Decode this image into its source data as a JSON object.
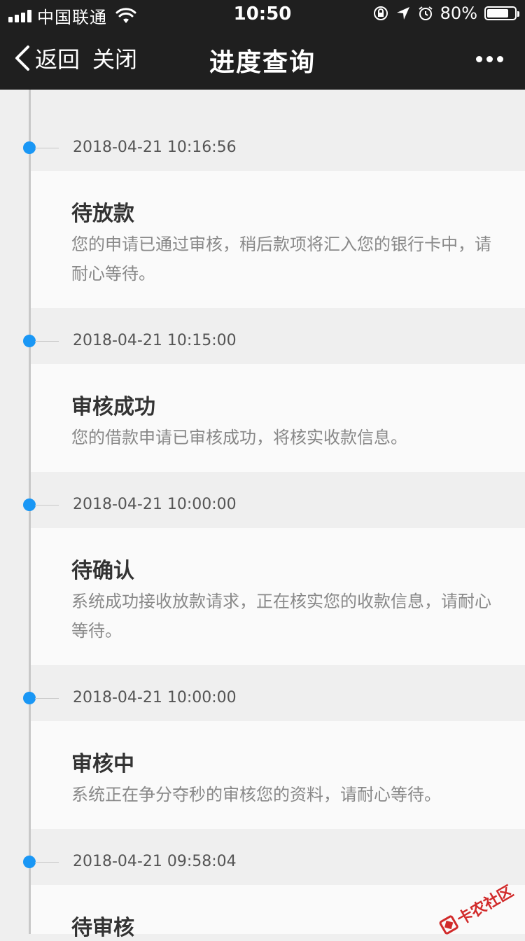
{
  "status_bar": {
    "carrier": "中国联通",
    "time": "10:50",
    "battery": "80%"
  },
  "nav": {
    "back_label": "返回",
    "close_label": "关闭",
    "title": "进度查询"
  },
  "entries": [
    {
      "time": "2018-04-21 10:16:56",
      "title": "待放款",
      "desc": "您的申请已通过审核，稍后款项将汇入您的银行卡中，请耐心等待。"
    },
    {
      "time": "2018-04-21 10:15:00",
      "title": "审核成功",
      "desc": "您的借款申请已审核成功，将核实收款信息。"
    },
    {
      "time": "2018-04-21 10:00:00",
      "title": "待确认",
      "desc": "系统成功接收放款请求，正在核实您的收款信息，请耐心等待。"
    },
    {
      "time": "2018-04-21 10:00:00",
      "title": "审核中",
      "desc": "系统正在争分夺秒的审核您的资料，请耐心等待。"
    },
    {
      "time": "2018-04-21 09:58:04",
      "title": "待审核",
      "desc": ""
    }
  ],
  "watermark": {
    "text": "卡农社区"
  },
  "colors": {
    "dot": "#1a97f5",
    "header_bg": "#1f1f1f",
    "page_bg": "#efefef",
    "card_bg": "#fafafa"
  }
}
